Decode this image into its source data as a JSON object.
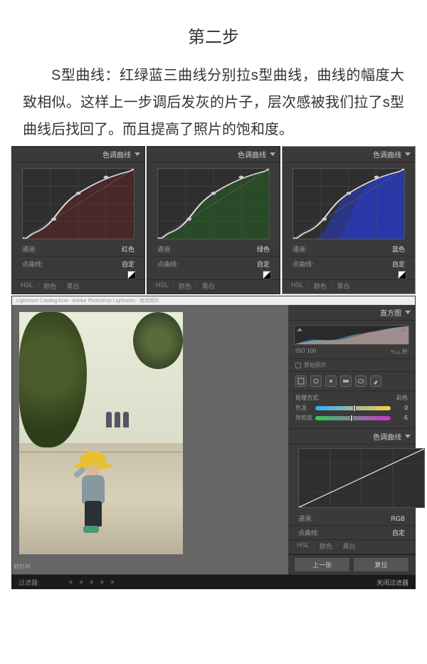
{
  "title": "第二步",
  "body_text": "S型曲线：红绿蓝三曲线分别拉s型曲线，曲线的幅度大致相似。这样上一步调后发灰的片子，层次感被我们拉了s型曲线后找回了。而且提高了照片的饱和度。",
  "tone_panels": [
    {
      "header": "色调曲线",
      "channel_label": "通道:",
      "channel": "红色",
      "point_label": "点曲线:",
      "point": "自定",
      "tabs": [
        "HSL",
        "/",
        "颜色",
        "/",
        "黑白"
      ],
      "curve_fill": "#4a2828"
    },
    {
      "header": "色调曲线",
      "channel_label": "通道:",
      "channel": "绿色",
      "point_label": "点曲线:",
      "point": "自定",
      "tabs": [
        "HSL",
        "/",
        "颜色",
        "/",
        "黑白"
      ],
      "curve_fill": "#284a28"
    },
    {
      "header": "色调曲线",
      "channel_label": "通道:",
      "channel": "蓝色",
      "point_label": "点曲线:",
      "point": "自定",
      "tabs": [
        "HSL",
        "/",
        "颜色",
        "/",
        "黑白"
      ],
      "curve_fill": "#2838a8"
    }
  ],
  "lr": {
    "titlebar": "Lightroom Catalog.lrcat - Adobe Photoshop Lightroom - 修改照片",
    "soft": "软打样",
    "histogram_header": "直方图",
    "iso": "ISO 100",
    "shutter": "¹⁄₂₀₀ 秒",
    "original": "原始照片",
    "wb": {
      "label": "处理方式:",
      "value": "彩色",
      "temp_label": "色温",
      "temp_val": "0",
      "tint_label": "饱和度",
      "tint_val": "-5"
    },
    "tone": {
      "header": "色调曲线",
      "channel_label": "通道:",
      "channel": "RGB",
      "point_label": "点曲线:",
      "point": "自定",
      "tabs": [
        "HSL",
        "/",
        "颜色",
        "/",
        "黑白"
      ]
    },
    "nav": {
      "prev": "上一张",
      "reset": "复位"
    },
    "filter": {
      "label": "过滤器:",
      "close": "关闭过滤器"
    }
  }
}
